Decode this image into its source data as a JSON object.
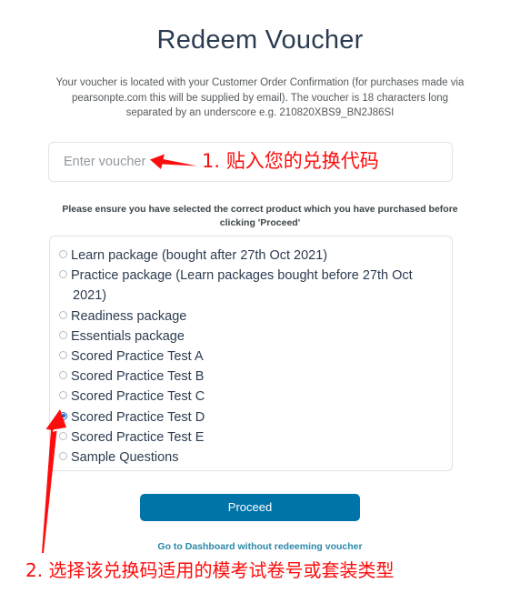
{
  "page": {
    "title": "Redeem Voucher",
    "intro": "Your voucher is located with your Customer Order Confirmation (for purchases made via pearsonpte.com this will be supplied by email). The voucher is 18 characters long separated by an underscore e.g. 210820XBS9_BN2J86SI",
    "note": "Please ensure you have selected the correct product which you have purchased before clicking 'Proceed'"
  },
  "voucher": {
    "placeholder": "Enter voucher",
    "value": ""
  },
  "products": {
    "selected_index": 8,
    "options": [
      {
        "label": "Learn package (bought after 27th Oct 2021)",
        "checked": false
      },
      {
        "label": "Practice package (Learn packages bought before 27th Oct 2021)",
        "checked": false
      },
      {
        "label": "Readiness package",
        "checked": false
      },
      {
        "label": "Essentials package",
        "checked": false
      },
      {
        "label": "Scored Practice Test A",
        "checked": false
      },
      {
        "label": "Scored Practice Test B",
        "checked": false
      },
      {
        "label": "Scored Practice Test C",
        "checked": false
      },
      {
        "label": "Scored Practice Test D",
        "checked": true
      },
      {
        "label": "Scored Practice Test E",
        "checked": false
      },
      {
        "label": "Sample Questions",
        "checked": false
      }
    ]
  },
  "actions": {
    "proceed_label": "Proceed",
    "dashboard_link_label": "Go to Dashboard without redeeming voucher"
  },
  "annotations": [
    {
      "id": "step-1",
      "text": "1. 贴入您的兑换代码",
      "color": "#fc0d0d",
      "arrow": "left-arrow"
    },
    {
      "id": "step-2",
      "text": "2. 选择该兑换码适用的模考试卷号或套装类型",
      "color": "#fc0d0d",
      "arrow": "up-right-arrow"
    }
  ],
  "colors": {
    "accent_button": "#0073a8",
    "link": "#2b87a8",
    "annotation": "#fc0d0d",
    "title": "#2c3c50",
    "border": "#e2e4e6",
    "radio_selected": "#1565c0"
  }
}
